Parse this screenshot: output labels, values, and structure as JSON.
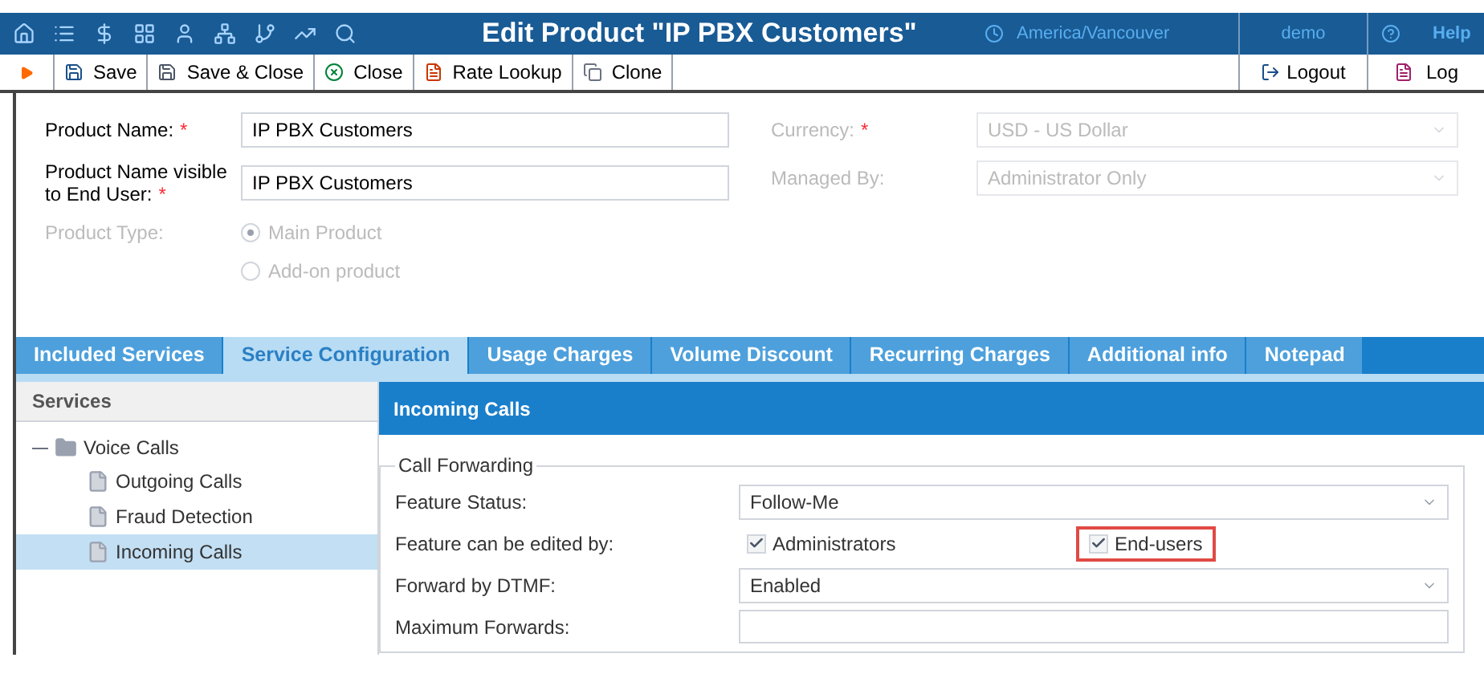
{
  "header": {
    "title": "Edit Product \"IP PBX Customers\"",
    "timezone": "America/Vancouver",
    "user": "demo",
    "help": "Help"
  },
  "toolbar": {
    "buttons": [
      {
        "label": "Save",
        "kind": "save"
      },
      {
        "label": "Save & Close",
        "kind": "save-close"
      },
      {
        "label": "Close",
        "kind": "close"
      },
      {
        "label": "Rate Lookup",
        "kind": "lookup"
      },
      {
        "label": "Clone",
        "kind": "clone"
      }
    ],
    "logout": "Logout",
    "log": "Log"
  },
  "form": {
    "product_name": {
      "label": "Product Name:",
      "value": "IP PBX Customers",
      "required_mark": "*"
    },
    "visible_name": {
      "label_1": "Product Name visible",
      "label_2": "to End User:",
      "value": "IP PBX Customers",
      "required_mark": "*"
    },
    "currency": {
      "label": "Currency:",
      "value": "USD - US Dollar",
      "required_mark": "*",
      "disabled": true
    },
    "managed_by": {
      "label": "Managed By:",
      "value": "Administrator Only",
      "disabled": true
    },
    "product_type": {
      "label": "Product Type:",
      "disabled": true,
      "options": [
        {
          "label": "Main Product",
          "selected": true
        },
        {
          "label": "Add-on product",
          "selected": false
        }
      ]
    }
  },
  "tabs": [
    {
      "label": "Included Services",
      "selected": false
    },
    {
      "label": "Service Configuration",
      "selected": true
    },
    {
      "label": "Usage Charges",
      "selected": false
    },
    {
      "label": "Volume Discount",
      "selected": false
    },
    {
      "label": "Recurring Charges",
      "selected": false
    },
    {
      "label": "Additional info",
      "selected": false
    },
    {
      "label": "Notepad",
      "selected": false
    }
  ],
  "services": {
    "title": "Services",
    "tree": [
      {
        "label": "Voice Calls",
        "expanded": true,
        "selected": false,
        "children": [
          {
            "label": "Outgoing Calls",
            "selected": false
          },
          {
            "label": "Fraud Detection",
            "selected": false
          },
          {
            "label": "Incoming Calls",
            "selected": true
          }
        ]
      }
    ]
  },
  "panel": {
    "title": "Incoming Calls",
    "group": "Call Forwarding",
    "rows": [
      {
        "kind": "select",
        "label": "Feature Status:",
        "value": "Follow-Me"
      },
      {
        "kind": "checks",
        "label": "Feature can be edited by:",
        "options": [
          {
            "label": "Administrators",
            "checked": true,
            "highlighted": false
          },
          {
            "label": "End-users",
            "checked": true,
            "highlighted": true
          }
        ]
      },
      {
        "kind": "select",
        "label": "Forward by DTMF:",
        "value": "Enabled"
      },
      {
        "kind": "input",
        "label": "Maximum Forwards:"
      }
    ]
  }
}
